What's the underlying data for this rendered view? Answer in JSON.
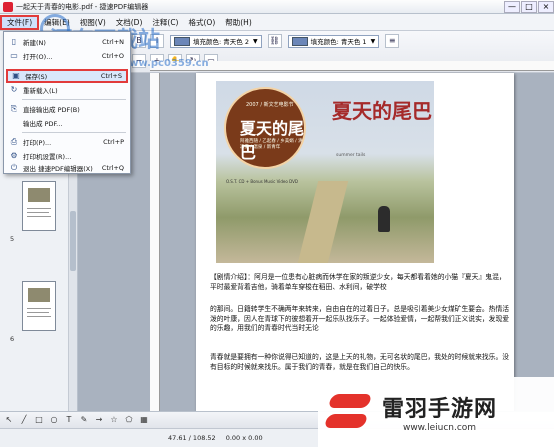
{
  "window": {
    "title": "一起天于青春的电影.pdf - 捷速PDF编辑器",
    "controls": [
      "—",
      "□",
      "×"
    ]
  },
  "menu": {
    "items": [
      {
        "label": "文件(F)",
        "active": true
      },
      {
        "label": "编辑(E)"
      },
      {
        "label": "视图(V)"
      },
      {
        "label": "文档(D)"
      },
      {
        "label": "注释(C)"
      },
      {
        "label": "格式(O)"
      },
      {
        "label": "帮助(H)"
      }
    ]
  },
  "file_menu": {
    "items": [
      {
        "label": "新建(N)",
        "shortcut": "Ctrl+N",
        "icon": "new-file-icon"
      },
      {
        "label": "打开(O)...",
        "shortcut": "Ctrl+O",
        "icon": "open-folder-icon"
      },
      {
        "label": "保存(S)",
        "shortcut": "Ctrl+S",
        "icon": "save-icon"
      },
      {
        "label": "另存为(A)...",
        "shortcut": "",
        "icon": "save-as-icon"
      },
      {
        "label": "重新载入(L)",
        "shortcut": "",
        "icon": "reload-icon"
      },
      {
        "label": "直接输出成 PDF(B)",
        "shortcut": "",
        "icon": "export-pdf-icon"
      },
      {
        "label": "输出成 PDF...",
        "shortcut": "",
        "icon": "export-icon"
      },
      {
        "label": "打印(P)...",
        "shortcut": "Ctrl+P",
        "icon": "print-icon"
      },
      {
        "label": "打印机设置(R)...",
        "shortcut": "",
        "icon": "printer-settings-icon"
      },
      {
        "label": "退出 捷速PDF编辑器(X)",
        "shortcut": "Ctrl+Q",
        "icon": "exit-icon"
      }
    ]
  },
  "toolbar": {
    "fill_style": "填充颜色: 青天色 2",
    "fill_style_2": "填充颜色: 青天色 1",
    "zoom_label": "缩放"
  },
  "thumbnails": {
    "page_labels": [
      "4",
      "5",
      "6"
    ]
  },
  "document": {
    "cover_title": "夏天的尾巴",
    "cover_badge_title": "夏天的尾巴",
    "cover_badge_sub": "2007 / 新文艺电影节",
    "cover_badge_lines": "阿雅西随 / 乙起春 / 乡美娟 / 清凉夏 / 温泉 / 新青年",
    "cover_credits": "O.S.T. CD + Bonus Music Video DVD",
    "cover_small": "summer tails",
    "paragraph1": "【剧情介绍】：阿月是一位患有心脏病而休学在家的叛逆少女，每天都看着她的小猫『夏天』鬼混，平时最爱背着吉他，骑着单车穿梭在稻田、水利间，破学校",
    "paragraph2": "的那间。日籍转学生不确两年来转来，自由自在的过着日子。总是吸引着美少女煤矿生要会。热情活泼的叶康，因人在青球下的彼想着开一起乐队找乐子。一起体验爱情，一起帮我们正义说实，发现爱的乐趣，用我们的青春时代当时无论",
    "paragraph3": "青春就是要拥有一种你说得已知道的，这是上天的礼物，无可名状的尾巴，我处的时候就来找乐。没有目标的时候就来找乐。属于我们的青春，就是在我们自己的快乐。"
  },
  "watermark": {
    "text": "河东下载站",
    "url": "www.pc0359.cn"
  },
  "status": {
    "coords": "47.61 / 108.52",
    "zoom": "0.00 x 0.00"
  },
  "brand": {
    "name": "雷羽手游网",
    "url": "www.leiucn.com"
  },
  "colors": {
    "highlight": "#e23b3b",
    "menu_active_bg": "#cfe1fb",
    "brand_red": "#e4322b"
  }
}
